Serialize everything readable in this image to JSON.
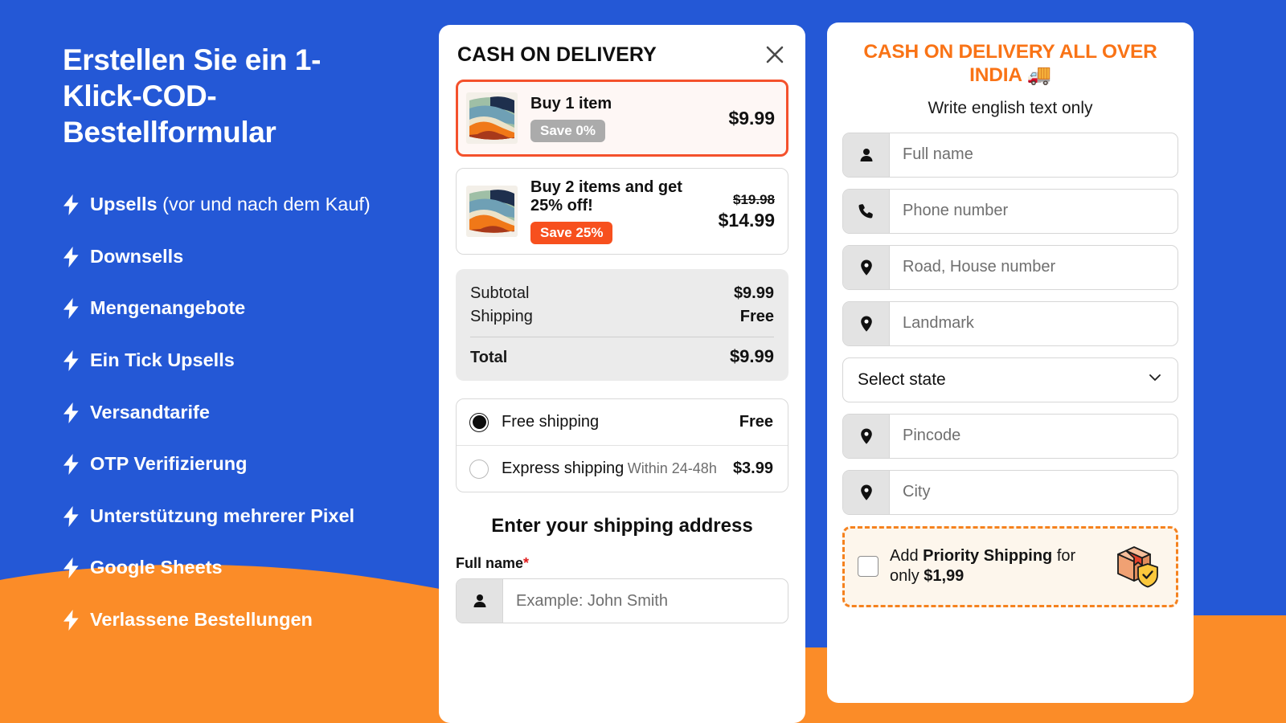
{
  "theme": {
    "blue": "#2458D6",
    "orange": "#FB8C28",
    "accent_red": "#F4512C",
    "badge_hot": "#F7501E",
    "badge_grey": "#ABABAB",
    "india_orange": "#F97316",
    "dashed_orange": "#F5821F",
    "required_red": "#E01B1B"
  },
  "promo": {
    "title": "Erstellen Sie ein 1-Klick-COD-Bestellformular",
    "features": [
      {
        "strong": "Upsells",
        "rest": " (vor und nach dem Kauf)"
      },
      {
        "strong": "Downsells",
        "rest": ""
      },
      {
        "strong": "Mengenangebote",
        "rest": ""
      },
      {
        "strong": "Ein Tick Upsells",
        "rest": ""
      },
      {
        "strong": "Versandtarife",
        "rest": ""
      },
      {
        "strong": "OTP Verifizierung",
        "rest": ""
      },
      {
        "strong": "Unterstützung mehrerer Pixel",
        "rest": ""
      },
      {
        "strong": "Google Sheets",
        "rest": ""
      },
      {
        "strong": "Verlassene Bestellungen",
        "rest": ""
      }
    ]
  },
  "checkout": {
    "title": "CASH ON DELIVERY",
    "close_icon": "close-icon",
    "offers": [
      {
        "name": "Buy 1 item",
        "badge": "Save 0%",
        "badge_style": "grey",
        "price_old": "",
        "price_now": "$9.99",
        "selected": true
      },
      {
        "name": "Buy 2 items and get 25% off!",
        "badge": "Save 25%",
        "badge_style": "hot",
        "price_old": "$19.98",
        "price_now": "$14.99",
        "selected": false
      }
    ],
    "summary": {
      "subtotal_label": "Subtotal",
      "subtotal_value": "$9.99",
      "shipping_label": "Shipping",
      "shipping_value": "Free",
      "total_label": "Total",
      "total_value": "$9.99"
    },
    "shipping_methods": [
      {
        "name": "Free shipping",
        "sub": "",
        "price": "Free",
        "selected": true
      },
      {
        "name": "Express shipping",
        "sub": "Within 24-48h",
        "price": "$3.99",
        "selected": false
      }
    ],
    "address": {
      "heading": "Enter your shipping address",
      "fullname_label": "Full name",
      "required_mark": "*",
      "fullname_placeholder": "Example: John Smith",
      "fullname_value": ""
    }
  },
  "india": {
    "title": "CASH ON DELIVERY ALL OVER INDIA 🚚",
    "subtitle": "Write english text only",
    "fields": [
      {
        "icon": "person-icon",
        "placeholder": "Full name",
        "value": ""
      },
      {
        "icon": "phone-icon",
        "placeholder": "Phone number",
        "value": ""
      },
      {
        "icon": "location-pin-icon",
        "placeholder": "Road, House number",
        "value": ""
      },
      {
        "icon": "location-pin-icon",
        "placeholder": "Landmark",
        "value": ""
      }
    ],
    "state_select": {
      "value": "Select state",
      "icon": "chevron-down-icon"
    },
    "fields_after": [
      {
        "icon": "location-pin-icon",
        "placeholder": "Pincode",
        "value": ""
      },
      {
        "icon": "location-pin-icon",
        "placeholder": "City",
        "value": ""
      }
    ],
    "priority": {
      "prefix": "Add ",
      "strong": "Priority Shipping",
      "middle": " for only ",
      "price": "$1,99",
      "checked": false,
      "icon": "package-shield-icon"
    }
  }
}
